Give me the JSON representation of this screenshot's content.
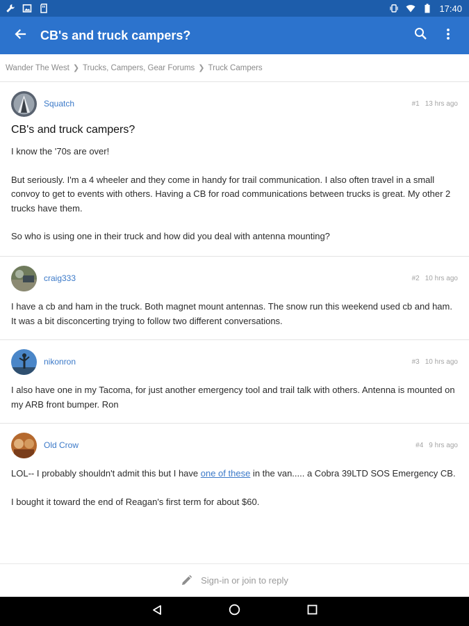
{
  "status_bar": {
    "time": "17:40",
    "left_icons": [
      "wrench-icon",
      "image-icon",
      "sd-card-icon"
    ],
    "right_icons": [
      "vibrate-icon",
      "wifi-icon",
      "battery-icon"
    ]
  },
  "app_bar": {
    "title": "CB's and truck campers?",
    "icons": [
      "back-arrow-icon",
      "search-icon",
      "more-vert-icon"
    ],
    "background": "#2c73cd"
  },
  "breadcrumb": [
    "Wander The West",
    "Trucks, Campers, Gear Forums",
    "Truck Campers"
  ],
  "posts": [
    {
      "author": "Squatch",
      "number": "#1",
      "time": "13 hrs ago",
      "title": "CB's and truck campers?",
      "paragraphs": [
        "I know the '70s are over!",
        "But seriously. I'm a 4 wheeler and they come in handy for trail communication. I also often travel in a small convoy to get to events with others. Having a CB for road communications between trucks is great. My other 2 trucks have them.",
        "So who is using one in their truck and how did you deal with antenna mounting?"
      ]
    },
    {
      "author": "craig333",
      "number": "#2",
      "time": "10 hrs ago",
      "paragraphs": [
        "I have a cb and ham in the truck. Both magnet mount antennas. The snow run this weekend used cb and ham. It was a bit disconcerting trying to follow two different conversations."
      ]
    },
    {
      "author": "nikonron",
      "number": "#3",
      "time": "10 hrs ago",
      "paragraphs": [
        "I also have one in my Tacoma, for just another emergency tool and trail talk with others. Antenna is mounted on my ARB front bumper. Ron"
      ]
    },
    {
      "author": "Old Crow",
      "number": "#4",
      "time": "9 hrs ago",
      "para1_before": "LOL-- I probably shouldn't admit this but I have ",
      "para1_link": "one of these",
      "para1_after": " in the van..... a Cobra 39LTD SOS Emergency CB.",
      "para2": "I bought it toward the end of Reagan's first term for about $60."
    }
  ],
  "footer": {
    "text": "Sign-in or join to reply",
    "icon": "pencil-icon"
  },
  "nav_bar": {
    "icons": [
      "back-triangle-icon",
      "home-circle-icon",
      "recents-square-icon"
    ]
  },
  "colors": {
    "status_bar": "#1d5dab",
    "app_bar": "#2c73cd",
    "username": "#3b79c8",
    "link": "#3b79c8"
  }
}
